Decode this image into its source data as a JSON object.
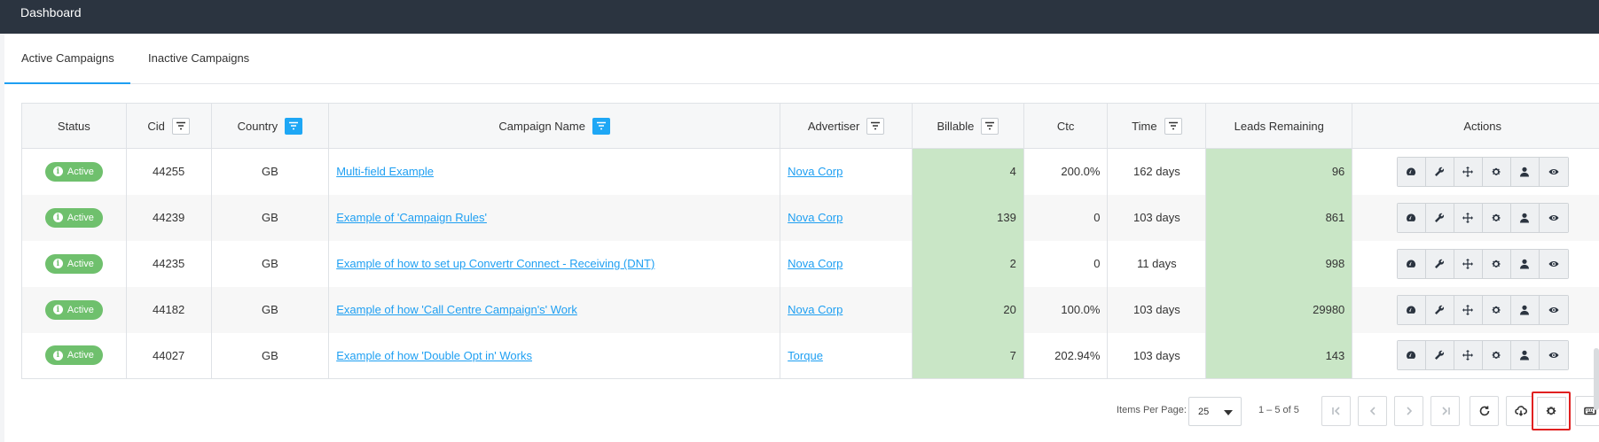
{
  "header": {
    "title": "Dashboard"
  },
  "tabs": [
    {
      "label": "Active Campaigns",
      "active": true
    },
    {
      "label": "Inactive Campaigns",
      "active": false
    }
  ],
  "table": {
    "columns": [
      {
        "label": "Status",
        "filter": false
      },
      {
        "label": "Cid",
        "filter": true,
        "filter_active": false
      },
      {
        "label": "Country",
        "filter": true,
        "filter_active": true
      },
      {
        "label": "Campaign Name",
        "filter": true,
        "filter_active": true
      },
      {
        "label": "Advertiser",
        "filter": true,
        "filter_active": false
      },
      {
        "label": "Billable",
        "filter": true,
        "filter_active": false
      },
      {
        "label": "Ctc",
        "filter": false
      },
      {
        "label": "Time",
        "filter": true,
        "filter_active": false
      },
      {
        "label": "Leads Remaining",
        "filter": false
      },
      {
        "label": "Actions",
        "filter": false
      }
    ],
    "rows": [
      {
        "status": "Active",
        "cid": "44255",
        "country": "GB",
        "name": "Multi-field Example",
        "advertiser": "Nova Corp",
        "billable": "4",
        "ctc": "200.0%",
        "time": "162 days",
        "leads": "96"
      },
      {
        "status": "Active",
        "cid": "44239",
        "country": "GB",
        "name": "Example of 'Campaign Rules'",
        "advertiser": "Nova Corp",
        "billable": "139",
        "ctc": "0",
        "time": "103 days",
        "leads": "861"
      },
      {
        "status": "Active",
        "cid": "44235",
        "country": "GB",
        "name": "Example of how to set up Convertr Connect - Receiving (DNT)",
        "advertiser": "Nova Corp",
        "billable": "2",
        "ctc": "0",
        "time": "11 days",
        "leads": "998"
      },
      {
        "status": "Active",
        "cid": "44182",
        "country": "GB",
        "name": "Example of how 'Call Centre Campaign's' Work",
        "advertiser": "Nova Corp",
        "billable": "20",
        "ctc": "100.0%",
        "time": "103 days",
        "leads": "29980"
      },
      {
        "status": "Active",
        "cid": "44027",
        "country": "GB",
        "name": "Example of how 'Double Opt in' Works",
        "advertiser": "Torque",
        "billable": "7",
        "ctc": "202.94%",
        "time": "103 days",
        "leads": "143"
      }
    ],
    "action_icons": [
      "dashboard-icon",
      "wrench-icon",
      "move-icon",
      "gear-icon",
      "user-icon",
      "eye-icon"
    ]
  },
  "pagination": {
    "items_per_page_label": "Items Per Page:",
    "items_per_page_value": "25",
    "range_text": "1 – 5 of 5"
  },
  "colors": {
    "topbar": "#2b3440",
    "accent": "#1e9ff2",
    "status_green": "#6fc06d",
    "highlight_green": "#c8e6c5",
    "focus_red": "#e02020"
  }
}
